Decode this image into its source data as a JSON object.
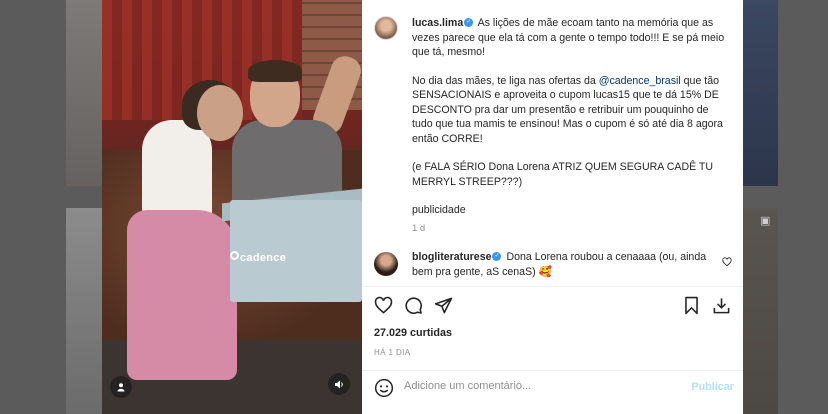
{
  "post": {
    "username": "lucas.lima",
    "caption_paragraphs": [
      "As lições de mãe ecoam tanto na memória que as vezes parece que ela tá com a gente o tempo todo!!! E se pá meio que tá, mesmo!",
      "No dia das mães, te liga nas ofertas da",
      "que tão SENSACIONAIS e aproveita o cupom lucas15 que te dá 15% DE DESCONTO pra dar um presentão e retribuir um pouquinho de tudo que tua mamis te ensinou! Mas o cupom é só até dia 8 agora então CORRE!",
      "(e FALA SÉRIO Dona Lorena ATRIZ QUEM SEGURA CADÊ TU MERRYL STREEP???)",
      "publicidade"
    ],
    "mention": "@cadence_brasil",
    "caption_age": "1 d",
    "photo_brand_text": "cadence"
  },
  "comment": {
    "username": "blogliteraturese",
    "text": "Dona Lorena roubou a cenaaaa (ou, ainda bem pra gente, aS cenaS) 🥰"
  },
  "stats": {
    "likes": "27.029 curtidas",
    "posted": "HÁ 1 DIA"
  },
  "add_comment": {
    "placeholder": "Adicione um comentário...",
    "publish_label": "Publicar"
  },
  "icons": {
    "like": "heart-icon",
    "comment": "comment-bubble-icon",
    "share": "paper-plane-icon",
    "save": "bookmark-icon",
    "download": "download-icon",
    "emoji": "smiley-icon",
    "tags": "user-tag-icon",
    "sound": "speaker-icon"
  },
  "colors": {
    "verified": "#3897f0",
    "mention": "#00376b",
    "publish_disabled": "#b2dffc",
    "muted_text": "#8e8e8e"
  }
}
